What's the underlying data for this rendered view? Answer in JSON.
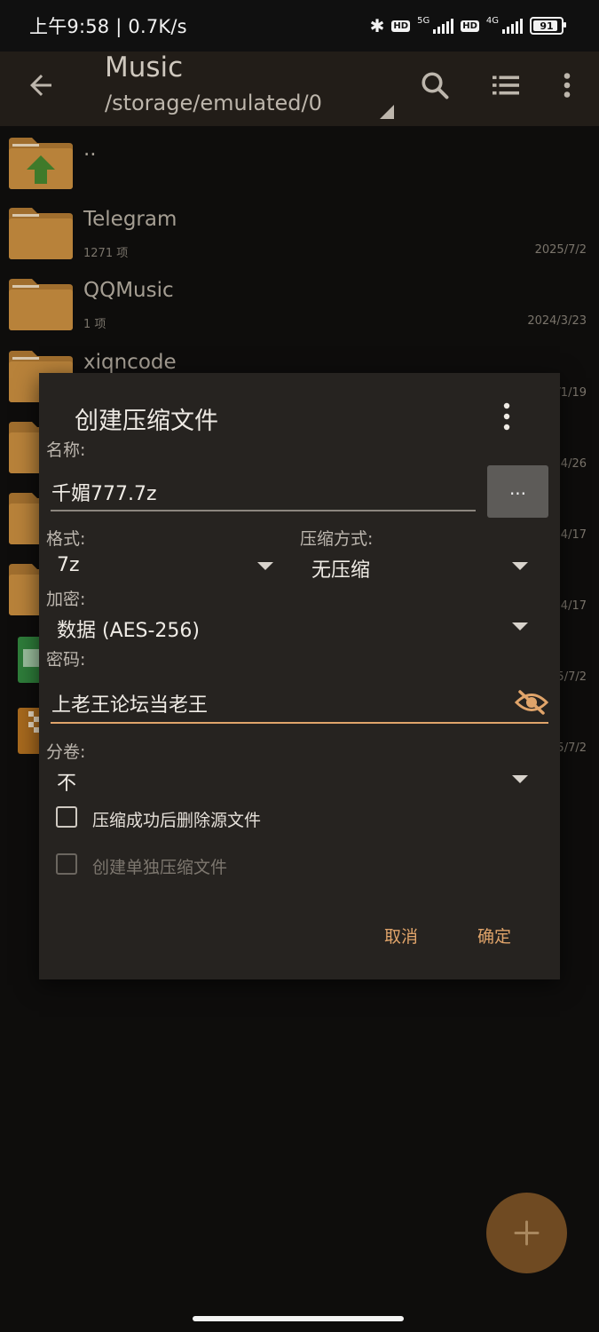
{
  "status_bar": {
    "time": "上午9:58 | 0.7K/s",
    "net1": "5G",
    "net2": "4G",
    "battery": "91",
    "battery_level": 0.91
  },
  "toolbar": {
    "title": "Music",
    "path": "/storage/emulated/0",
    "icons": [
      "back-arrow-icon",
      "search-icon",
      "list-view-icon",
      "more-vert-icon"
    ]
  },
  "files": [
    {
      "name": "..",
      "meta": "",
      "date": ""
    },
    {
      "name": "Telegram",
      "meta": "1271 项",
      "date": "2025/7/2"
    },
    {
      "name": "QQMusic",
      "meta": "1 项",
      "date": "2024/3/23"
    },
    {
      "name": "xiqncode",
      "meta": "",
      "date": "/1/19"
    },
    {
      "name": "",
      "meta": "",
      "date": "4/26"
    },
    {
      "name": "",
      "meta": "",
      "date": "4/17"
    },
    {
      "name": "",
      "meta": "",
      "date": "4/17"
    },
    {
      "name": "",
      "meta": "",
      "date": "5/7/2"
    },
    {
      "name": "",
      "meta": "",
      "date": "5/7/2"
    }
  ],
  "dialog": {
    "title": "创建压缩文件",
    "name_label": "名称:",
    "name_value": "千媚777.7z",
    "browse_label": "...",
    "format_label": "格式:",
    "format_value": "7z",
    "compress_label": "压缩方式:",
    "compress_value": "无压缩",
    "encrypt_label": "加密:",
    "encrypt_value": "数据 (AES-256)",
    "password_label": "密码:",
    "password_value": "上老王论坛当老王",
    "volume_label": "分卷:",
    "volume_value": "不",
    "checkbox1": "压缩成功后删除源文件",
    "checkbox2": "创建单独压缩文件",
    "cancel": "取消",
    "ok": "确定"
  },
  "colors": {
    "accent": "#e0a46a",
    "folder": "#b07a33",
    "fab": "#6f4a22"
  }
}
